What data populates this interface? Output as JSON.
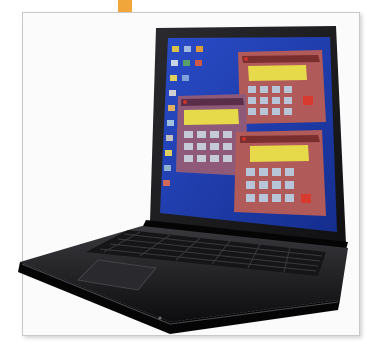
{
  "scene": {
    "subject": "laptop-icon",
    "screen": {
      "background_color": "#1e3aa8",
      "desktop_icons": [
        "folder-icon",
        "document-icon",
        "trash-icon",
        "network-icon",
        "printer-icon",
        "disk-icon"
      ],
      "calculator_windows": [
        {
          "display_color": "#e6d94a",
          "frame_color": "#b05a5a",
          "key_count": 12
        },
        {
          "display_color": "#e6d94a",
          "frame_color": "#8f5a7a",
          "key_count": 12
        },
        {
          "display_color": "#e6d94a",
          "frame_color": "#b05a5a",
          "key_count": 12
        }
      ],
      "accent_color": "#c8322c"
    },
    "body_color": "#1b1b1d",
    "watermark_color": "#9a9a9a",
    "tab_color": "#f0a63a"
  }
}
